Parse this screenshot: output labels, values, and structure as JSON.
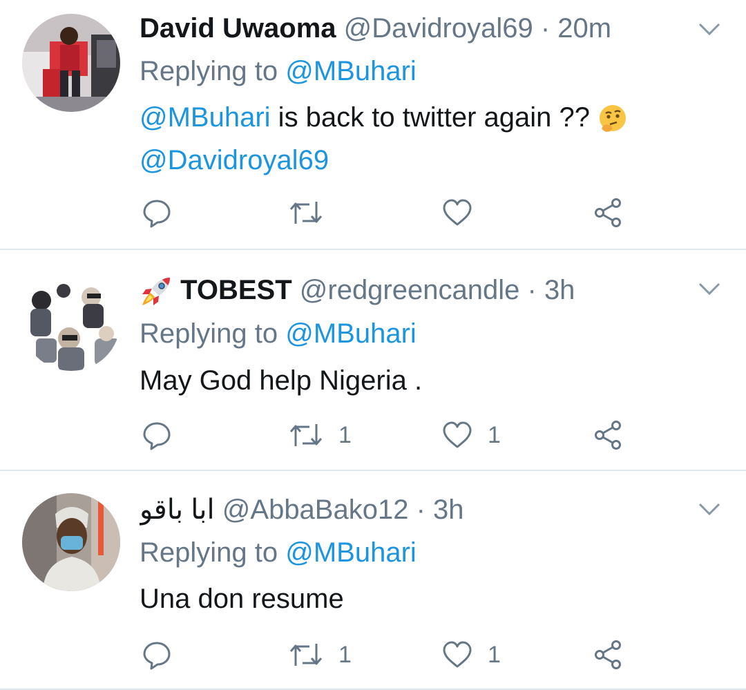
{
  "colors": {
    "link": "#1b95e0",
    "secondary_text": "#657786",
    "primary_text": "#14171a",
    "divider": "#e1e8ed",
    "icon": "#657786"
  },
  "tweets": [
    {
      "name": "David Uwaoma",
      "handle": "@Davidroyal69",
      "separator": "·",
      "time": "20m",
      "replying_prefix": "Replying to",
      "replying_to": "@MBuhari",
      "body_mention": "@MBuhari",
      "body_text": " is back to twitter again ?? ",
      "body_emoji": "thinking-face-emoji",
      "body_second_line": "@Davidroyal69",
      "reply_count": "",
      "retweet_count": "",
      "like_count": ""
    },
    {
      "name_icon": "rocket-emoji",
      "name": "TOBEST",
      "handle": "@redgreencandle",
      "separator": "·",
      "time": "3h",
      "replying_prefix": "Replying to",
      "replying_to": "@MBuhari",
      "body_text": "May God help  Nigeria .",
      "reply_count": "",
      "retweet_count": "1",
      "like_count": "1"
    },
    {
      "name": "ابا باقو",
      "handle": "@AbbaBako12",
      "separator": "·",
      "time": "3h",
      "replying_prefix": "Replying to",
      "replying_to": "@MBuhari",
      "body_text": "Una don resume",
      "reply_count": "",
      "retweet_count": "1",
      "like_count": "1"
    }
  ]
}
